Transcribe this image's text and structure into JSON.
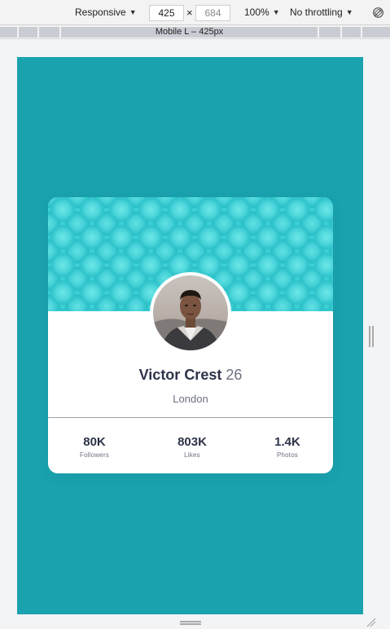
{
  "toolbar": {
    "device": "Responsive",
    "width": "425",
    "height": "684",
    "zoom": "100%",
    "throttling": "No throttling",
    "times": "×"
  },
  "media_bar": {
    "label": "Mobile L – 425px"
  },
  "profile": {
    "name": "Victor Crest",
    "age": "26",
    "city": "London",
    "stats": [
      {
        "value": "80K",
        "label": "Followers"
      },
      {
        "value": "803K",
        "label": "Likes"
      },
      {
        "value": "1.4K",
        "label": "Photos"
      }
    ]
  },
  "colors": {
    "viewport_bg": "#1aa2af",
    "banner": "#3ed0d6",
    "name_text": "#2e3349",
    "muted_text": "#6b7082"
  },
  "icons": [
    "caret-down-icon",
    "rotate-icon",
    "resize-handle-icon"
  ]
}
